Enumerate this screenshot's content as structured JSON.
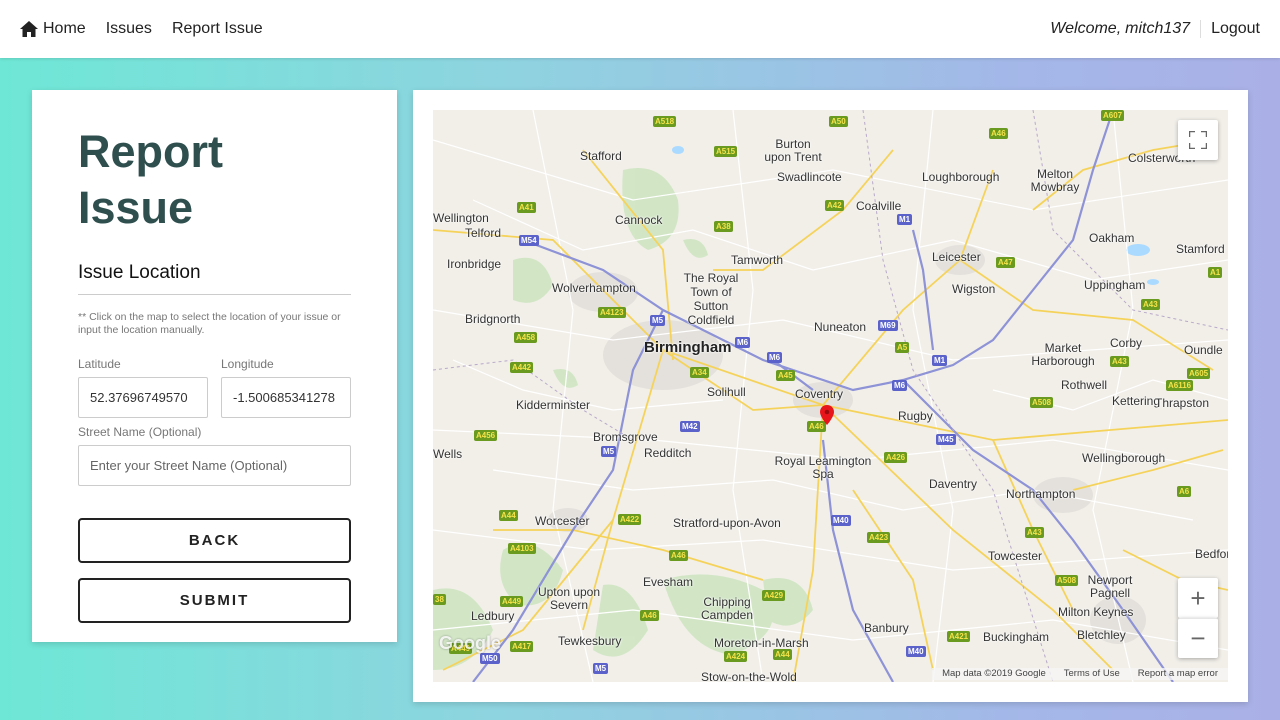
{
  "nav": {
    "home": "Home",
    "issues": "Issues",
    "report_issue": "Report Issue",
    "welcome_prefix": "Welcome,",
    "username": "mitch137",
    "logout": "Logout"
  },
  "form": {
    "title_line1": "Report",
    "title_line2": "Issue",
    "section_title": "Issue Location",
    "help_text": "** Click on the map to select the location of your issue or input the location manually.",
    "latitude_label": "Latitude",
    "latitude_value": "52.37696749570",
    "longitude_label": "Longitude",
    "longitude_value": "-1.500685341278",
    "street_label": "Street Name (Optional)",
    "street_placeholder": "Enter your Street Name (Optional)",
    "back_label": "BACK",
    "submit_label": "SUBMIT"
  },
  "map": {
    "places": [
      "Stafford",
      "Burton upon Trent",
      "Swadlincote",
      "Loughborough",
      "Melton Mowbray",
      "Colsterworth",
      "Wellington",
      "Telford",
      "Cannock",
      "Coalville",
      "Oakham",
      "Stamford",
      "Ironbridge",
      "Tamworth",
      "Leicester",
      "Uppingham",
      "Wolverhampton",
      "The Royal Town of Sutton Coldfield",
      "Wigston",
      "Bridgnorth",
      "Birmingham",
      "Nuneaton",
      "Market Harborough",
      "Corby",
      "Oundle",
      "Solihull",
      "Coventry",
      "Rothwell",
      "Kettering",
      "Thrapston",
      "Kidderminster",
      "Rugby",
      "Bromsgrove",
      "Redditch",
      "Royal Leamington Spa",
      "Wellingborough",
      "Wells",
      "Daventry",
      "Northampton",
      "Worcester",
      "Stratford-upon-Avon",
      "Towcester",
      "Bedford",
      "Evesham",
      "Upton upon Severn",
      "Chipping Campden",
      "Newport Pagnell",
      "Milton Keynes",
      "Ledbury",
      "Banbury",
      "Tewkesbury",
      "Moreton-in-Marsh",
      "Buckingham",
      "Bletchley",
      "Stow-on-the-Wold"
    ],
    "big_place": "Birmingham",
    "attribution_data": "Map data ©2019 Google",
    "terms": "Terms of Use",
    "report_error": "Report a map error",
    "google_logo": "Google",
    "zoom_in": "+",
    "zoom_out": "−"
  },
  "icons": {
    "home": "home-icon",
    "fullscreen": "fullscreen-icon",
    "marker": "map-marker-icon"
  },
  "colors": {
    "title": "#2f4f4f",
    "marker": "#e8161b",
    "a_road": "#6a9a1f",
    "motorway": "#5b62c9"
  }
}
